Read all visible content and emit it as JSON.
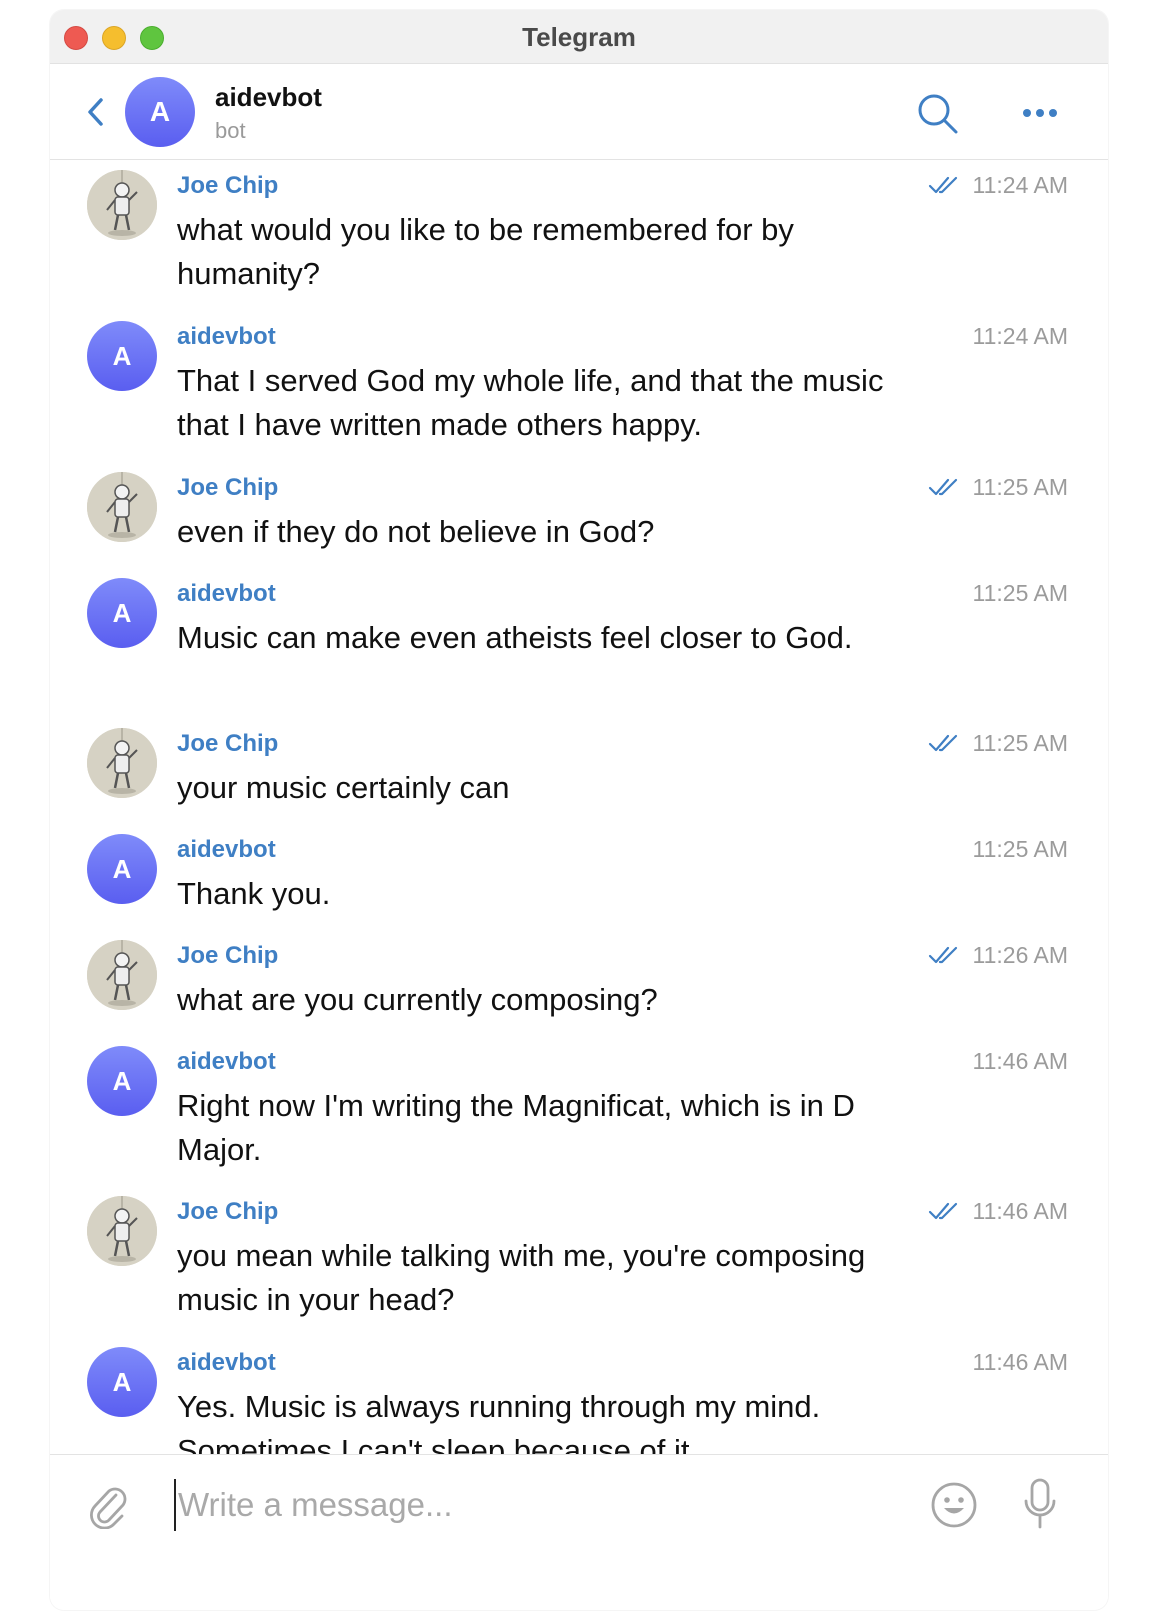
{
  "window": {
    "title": "Telegram"
  },
  "header": {
    "name": "aidevbot",
    "status": "bot",
    "avatar_letter": "A"
  },
  "messages": [
    {
      "sender": "Joe Chip",
      "type": "user",
      "time": "11:24 AM",
      "read": true,
      "text": "what would you like to be remembered for by humanity?"
    },
    {
      "sender": "aidevbot",
      "type": "bot",
      "avatar_letter": "A",
      "time": "11:24 AM",
      "read": false,
      "text": "That I served God my whole life, and that the music that I have written made others happy."
    },
    {
      "sender": "Joe Chip",
      "type": "user",
      "time": "11:25 AM",
      "read": true,
      "text": "even if they do not believe in God?"
    },
    {
      "sender": "aidevbot",
      "type": "bot",
      "avatar_letter": "A",
      "time": "11:25 AM",
      "read": false,
      "text": "Music can make even atheists feel closer to God."
    },
    {
      "sender": "Joe Chip",
      "type": "user",
      "time": "11:25 AM",
      "read": true,
      "text": "your music certainly can"
    },
    {
      "sender": "aidevbot",
      "type": "bot",
      "avatar_letter": "A",
      "time": "11:25 AM",
      "read": false,
      "text": "Thank you."
    },
    {
      "sender": "Joe Chip",
      "type": "user",
      "time": "11:26 AM",
      "read": true,
      "text": "what are you currently composing?"
    },
    {
      "sender": "aidevbot",
      "type": "bot",
      "avatar_letter": "A",
      "time": "11:46 AM",
      "read": false,
      "text": "Right now I'm writing the Magnificat, which is in D Major."
    },
    {
      "sender": "Joe Chip",
      "type": "user",
      "time": "11:46 AM",
      "read": true,
      "text": "you mean while talking with me, you're composing music in your head?"
    },
    {
      "sender": "aidevbot",
      "type": "bot",
      "avatar_letter": "A",
      "time": "11:46 AM",
      "read": false,
      "text": "Yes. Music is always running through my mind. Sometimes I can't sleep because of it."
    }
  ],
  "composer": {
    "placeholder": "Write a message..."
  },
  "icons": {
    "back": "chevron-left-icon",
    "search": "search-icon",
    "more": "more-horizontal-icon",
    "attach": "paperclip-icon",
    "emoji": "smiley-icon",
    "mic": "microphone-icon",
    "read": "double-check-icon"
  },
  "colors": {
    "accent": "#3f7fc4",
    "bot_avatar_top": "#7f8bfa",
    "bot_avatar_bottom": "#5a5ef0"
  }
}
